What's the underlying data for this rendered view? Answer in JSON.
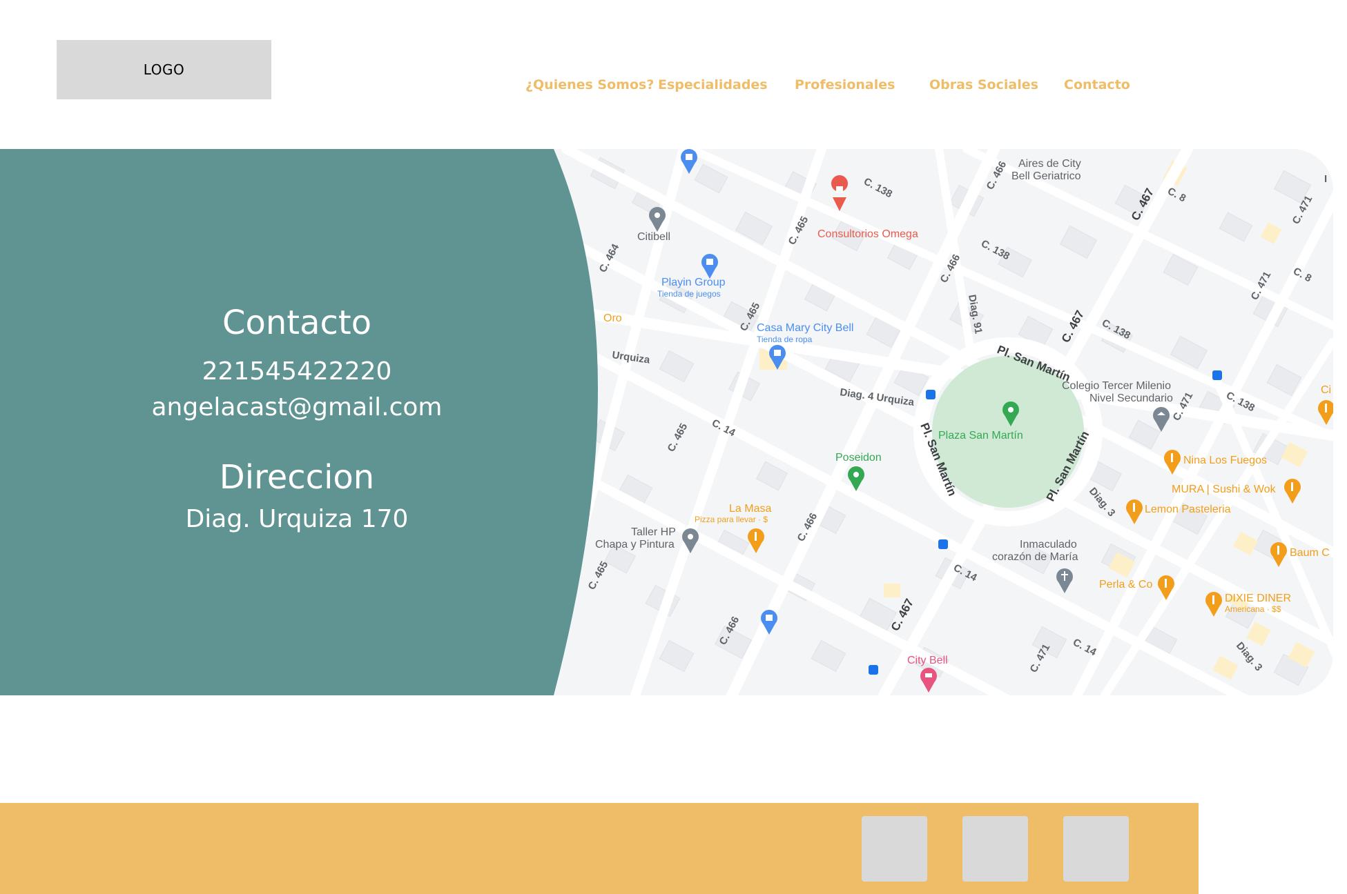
{
  "header": {
    "logo_text": "LOGO",
    "nav": [
      {
        "label": "¿Quienes Somos?"
      },
      {
        "label": "Especialidades"
      },
      {
        "label": "Profesionales"
      },
      {
        "label": "Obras Sociales"
      },
      {
        "label": "Contacto"
      }
    ]
  },
  "contact": {
    "title": "Contacto",
    "phone": "221545422220",
    "email": "angelacast@gmail.com",
    "address_title": "Direccion",
    "address": "Diag. Urquiza 170"
  },
  "map": {
    "places": {
      "aires": [
        "Aires de City",
        "Bell Geriatrico"
      ],
      "consultorios": "Consultorios Omega",
      "citibell": "Citibell",
      "playin": "Playin Group",
      "playin_sub": "Tienda de juegos",
      "casamary": "Casa Mary City Bell",
      "casamary_sub": "Tienda de ropa",
      "oro": "Oro",
      "plaza": "Plaza San Martín",
      "colegio": [
        "Colegio Tercer Milenio",
        "Nivel Secundario"
      ],
      "poseidon": "Poseidon",
      "lamasa": "La Masa",
      "lamasa_sub": "Pizza para llevar · $",
      "tallerhp": "Taller HP",
      "tallerhp_sub": "Chapa y Pintura",
      "ninalosfuegos": "Nina Los Fuegos",
      "mura": "MURA | Sushi & Wok",
      "lemon": "Lemon Pasteleria",
      "baum": "Baum C",
      "inmaculado": [
        "Inmaculado",
        "corazón de María"
      ],
      "perla": "Perla & Co",
      "dixie": "DIXIE DINER",
      "dixie_sub": "Americana · $$",
      "citybell": "City Bell",
      "ci": "Ci"
    },
    "streets": {
      "c138": "C. 138",
      "c466": "C. 466",
      "c467": "C. 467",
      "c465": "C. 465",
      "c464": "C. 464",
      "c8": "C. 8",
      "c471": "C. 471",
      "diag91": "Diag. 91",
      "plsanmartin": "Pl. San Martín",
      "urquiza": "Urquiza",
      "diag4urquiza": "Diag. 4 Urquiza",
      "c14": "C. 14",
      "diag3": "Diag. 3",
      "i": "I"
    },
    "colors": {
      "panel": "#5f9492",
      "road": "#ffffff",
      "block": "#e9ebee",
      "park": "#cfe9d4",
      "food_pin": "#f29e1b",
      "shop_pin": "#4b8ef0",
      "health_pin": "#ea5b4d",
      "generic_pin": "#7b8894",
      "park_pin": "#34a853",
      "hotel_pin": "#e75480"
    }
  },
  "footer": {
    "social_icons": [
      "social-icon-1",
      "social-icon-2",
      "social-icon-3"
    ]
  }
}
